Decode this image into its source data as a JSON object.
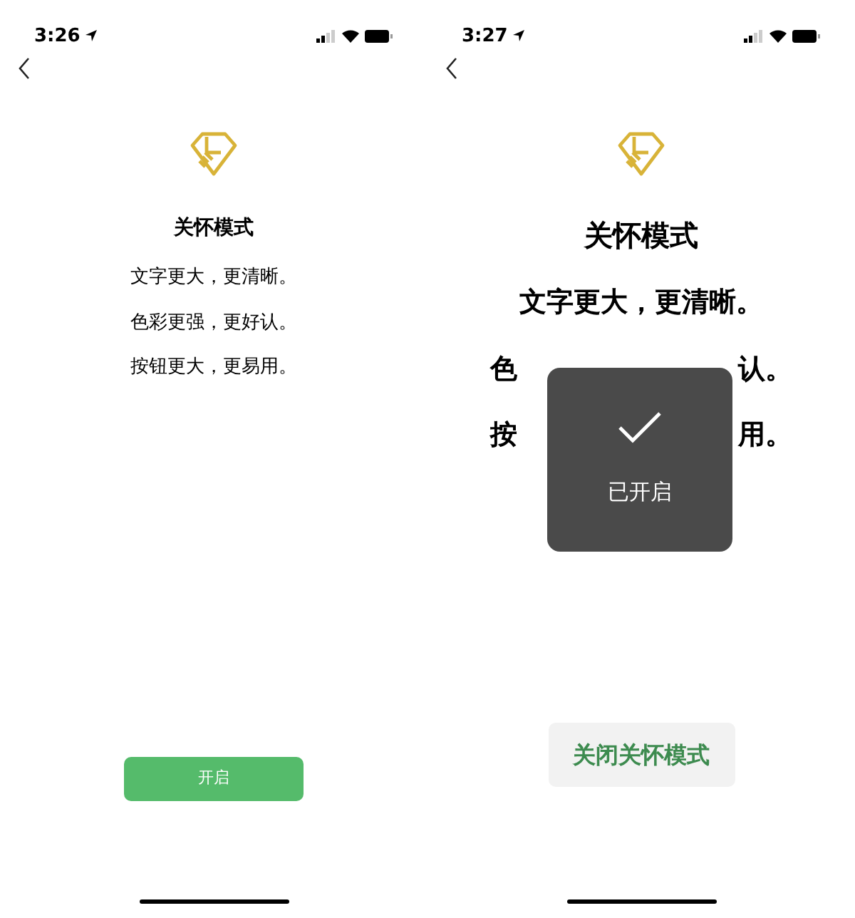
{
  "screens": [
    {
      "status_bar": {
        "time": "3:26"
      },
      "large_text": false,
      "title": "关怀模式",
      "lines": [
        {
          "parts": [
            "文字更大，更清晰。"
          ]
        },
        {
          "parts": [
            "色彩更强，更好认。"
          ]
        },
        {
          "parts": [
            "按钮更大，更易用。"
          ]
        }
      ],
      "button": {
        "label": "开启",
        "kind": "filled"
      }
    },
    {
      "status_bar": {
        "time": "3:27"
      },
      "large_text": true,
      "title": "关怀模式",
      "lines": [
        {
          "parts": [
            "文字更大，更清晰。"
          ]
        },
        {
          "parts": [
            "色",
            "认。"
          ]
        },
        {
          "parts": [
            "按",
            "用。"
          ]
        }
      ],
      "toast": {
        "label": "已开启"
      },
      "button": {
        "label": "关闭关怀模式",
        "kind": "tinted"
      }
    }
  ]
}
